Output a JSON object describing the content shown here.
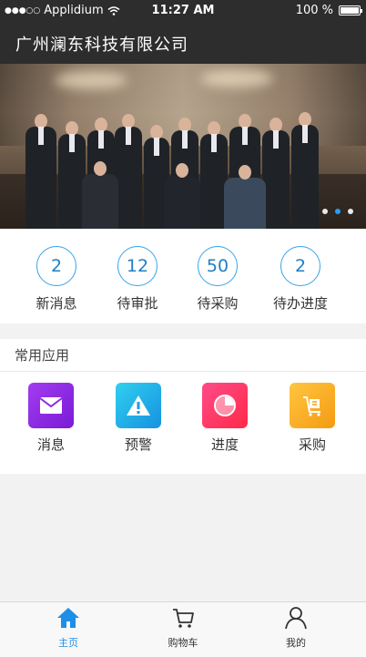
{
  "status_bar": {
    "carrier": "Applidium",
    "time": "11:27 AM",
    "battery": "100 %"
  },
  "nav": {
    "title": "广州澜东科技有限公司"
  },
  "banner": {
    "slide_count": 3,
    "active_slide": 2
  },
  "stats": [
    {
      "value": "2",
      "label": "新消息"
    },
    {
      "value": "12",
      "label": "待审批"
    },
    {
      "value": "50",
      "label": "待采购"
    },
    {
      "value": "2",
      "label": "待办进度"
    }
  ],
  "apps": {
    "header": "常用应用",
    "items": [
      {
        "label": "消息",
        "icon": "mail-icon",
        "color": "#8a2be2"
      },
      {
        "label": "预警",
        "icon": "warning-icon",
        "color": "#1e9be6"
      },
      {
        "label": "进度",
        "icon": "pie-chart-icon",
        "color": "#ff3366"
      },
      {
        "label": "采购",
        "icon": "cart-box-icon",
        "color": "#f7a823"
      }
    ]
  },
  "tabs": [
    {
      "label": "主页",
      "icon": "home-icon",
      "active": true
    },
    {
      "label": "购物车",
      "icon": "cart-icon",
      "active": false
    },
    {
      "label": "我的",
      "icon": "user-icon",
      "active": false
    }
  ],
  "colors": {
    "header_bg": "#2d2d2d",
    "accent": "#1f8ee6"
  }
}
